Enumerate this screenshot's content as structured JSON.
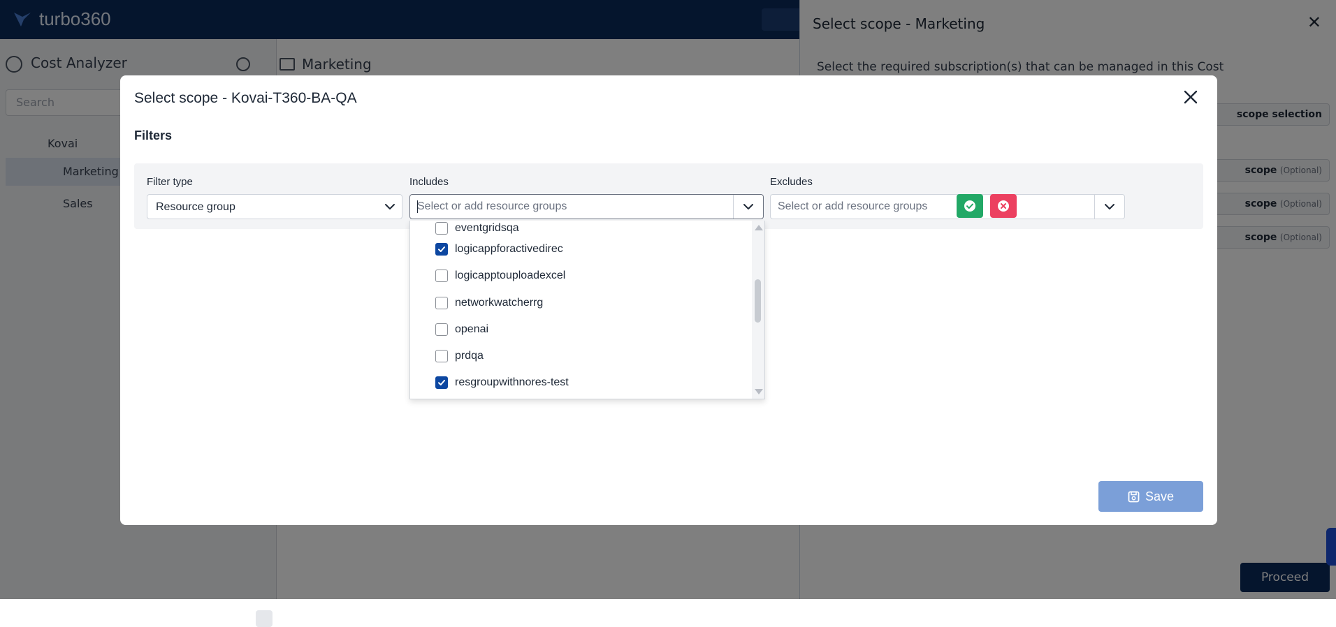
{
  "app": {
    "brand": "turbo360"
  },
  "background": {
    "left_panel": {
      "title": "Cost Analyzer",
      "search_placeholder": "Search",
      "tree": [
        "Kovai",
        "Marketing",
        "Sales"
      ]
    },
    "main": {
      "breadcrumb": "Marketing"
    },
    "right_panel": {
      "title": "Select scope - Marketing",
      "description": "Select the required subscription(s) that can be managed in this Cost",
      "scope_selection_label": "scope selection",
      "scope_label": "scope",
      "optional_label": "(Optional)",
      "proceed_label": "Proceed"
    }
  },
  "modal": {
    "title": "Select scope - Kovai-T360-BA-QA",
    "filters_label": "Filters",
    "filter_type": {
      "label": "Filter type",
      "value": "Resource group"
    },
    "includes": {
      "label": "Includes",
      "placeholder": "Select or add resource groups"
    },
    "excludes": {
      "label": "Excludes",
      "placeholder": "Select or add resource groups"
    },
    "dropdown_items": [
      {
        "label": "eventgridsqa",
        "checked": false
      },
      {
        "label": "logicappforactivedirec",
        "checked": true
      },
      {
        "label": "logicapptouploadexcel",
        "checked": false
      },
      {
        "label": "networkwatcherrg",
        "checked": false
      },
      {
        "label": "openai",
        "checked": false
      },
      {
        "label": "prdqa",
        "checked": false
      },
      {
        "label": "resgroupwithnores-test",
        "checked": true
      }
    ],
    "save_label": "Save"
  },
  "colors": {
    "header": "#0b2a5b",
    "apply": "#22a866",
    "clear": "#ec4060",
    "checkbox_checked": "#0d47a1",
    "save": "#7b9fd8"
  }
}
